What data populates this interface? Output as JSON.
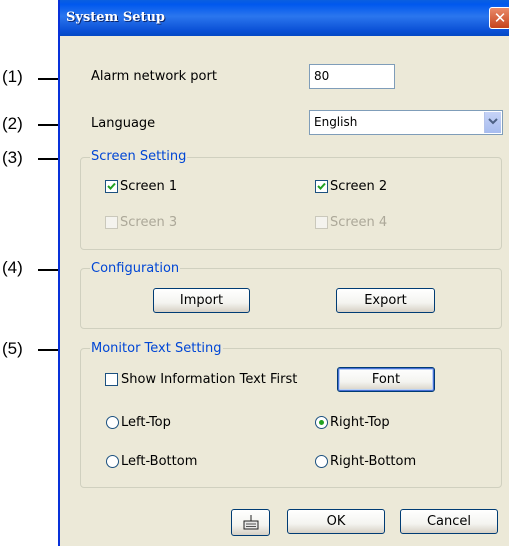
{
  "window": {
    "title": "System Setup",
    "close_glyph": "✕"
  },
  "callouts": [
    "(1)",
    "(2)",
    "(3)",
    "(4)",
    "(5)"
  ],
  "alarm_port": {
    "label": "Alarm network port",
    "value": "80"
  },
  "language": {
    "label": "Language",
    "selected": "English"
  },
  "screen_setting": {
    "title": "Screen Setting",
    "items": [
      {
        "label": "Screen 1",
        "checked": true,
        "enabled": true
      },
      {
        "label": "Screen 2",
        "checked": true,
        "enabled": true
      },
      {
        "label": "Screen 3",
        "checked": false,
        "enabled": false
      },
      {
        "label": "Screen 4",
        "checked": false,
        "enabled": false
      }
    ]
  },
  "configuration": {
    "title": "Configuration",
    "import_label": "Import",
    "export_label": "Export"
  },
  "monitor_text": {
    "title": "Monitor Text Setting",
    "show_info_label": "Show Information Text First",
    "show_info_checked": false,
    "font_label": "Font",
    "positions": [
      {
        "label": "Left-Top",
        "selected": false
      },
      {
        "label": "Right-Top",
        "selected": true
      },
      {
        "label": "Left-Bottom",
        "selected": false
      },
      {
        "label": "Right-Bottom",
        "selected": false
      }
    ]
  },
  "footer": {
    "ok_label": "OK",
    "cancel_label": "Cancel",
    "keyboard_icon": "keyboard-icon"
  },
  "colors": {
    "title_bar": "#0058ee",
    "dialog_bg": "#ece9d8",
    "group_title": "#0046d5",
    "close": "#c6431c"
  }
}
